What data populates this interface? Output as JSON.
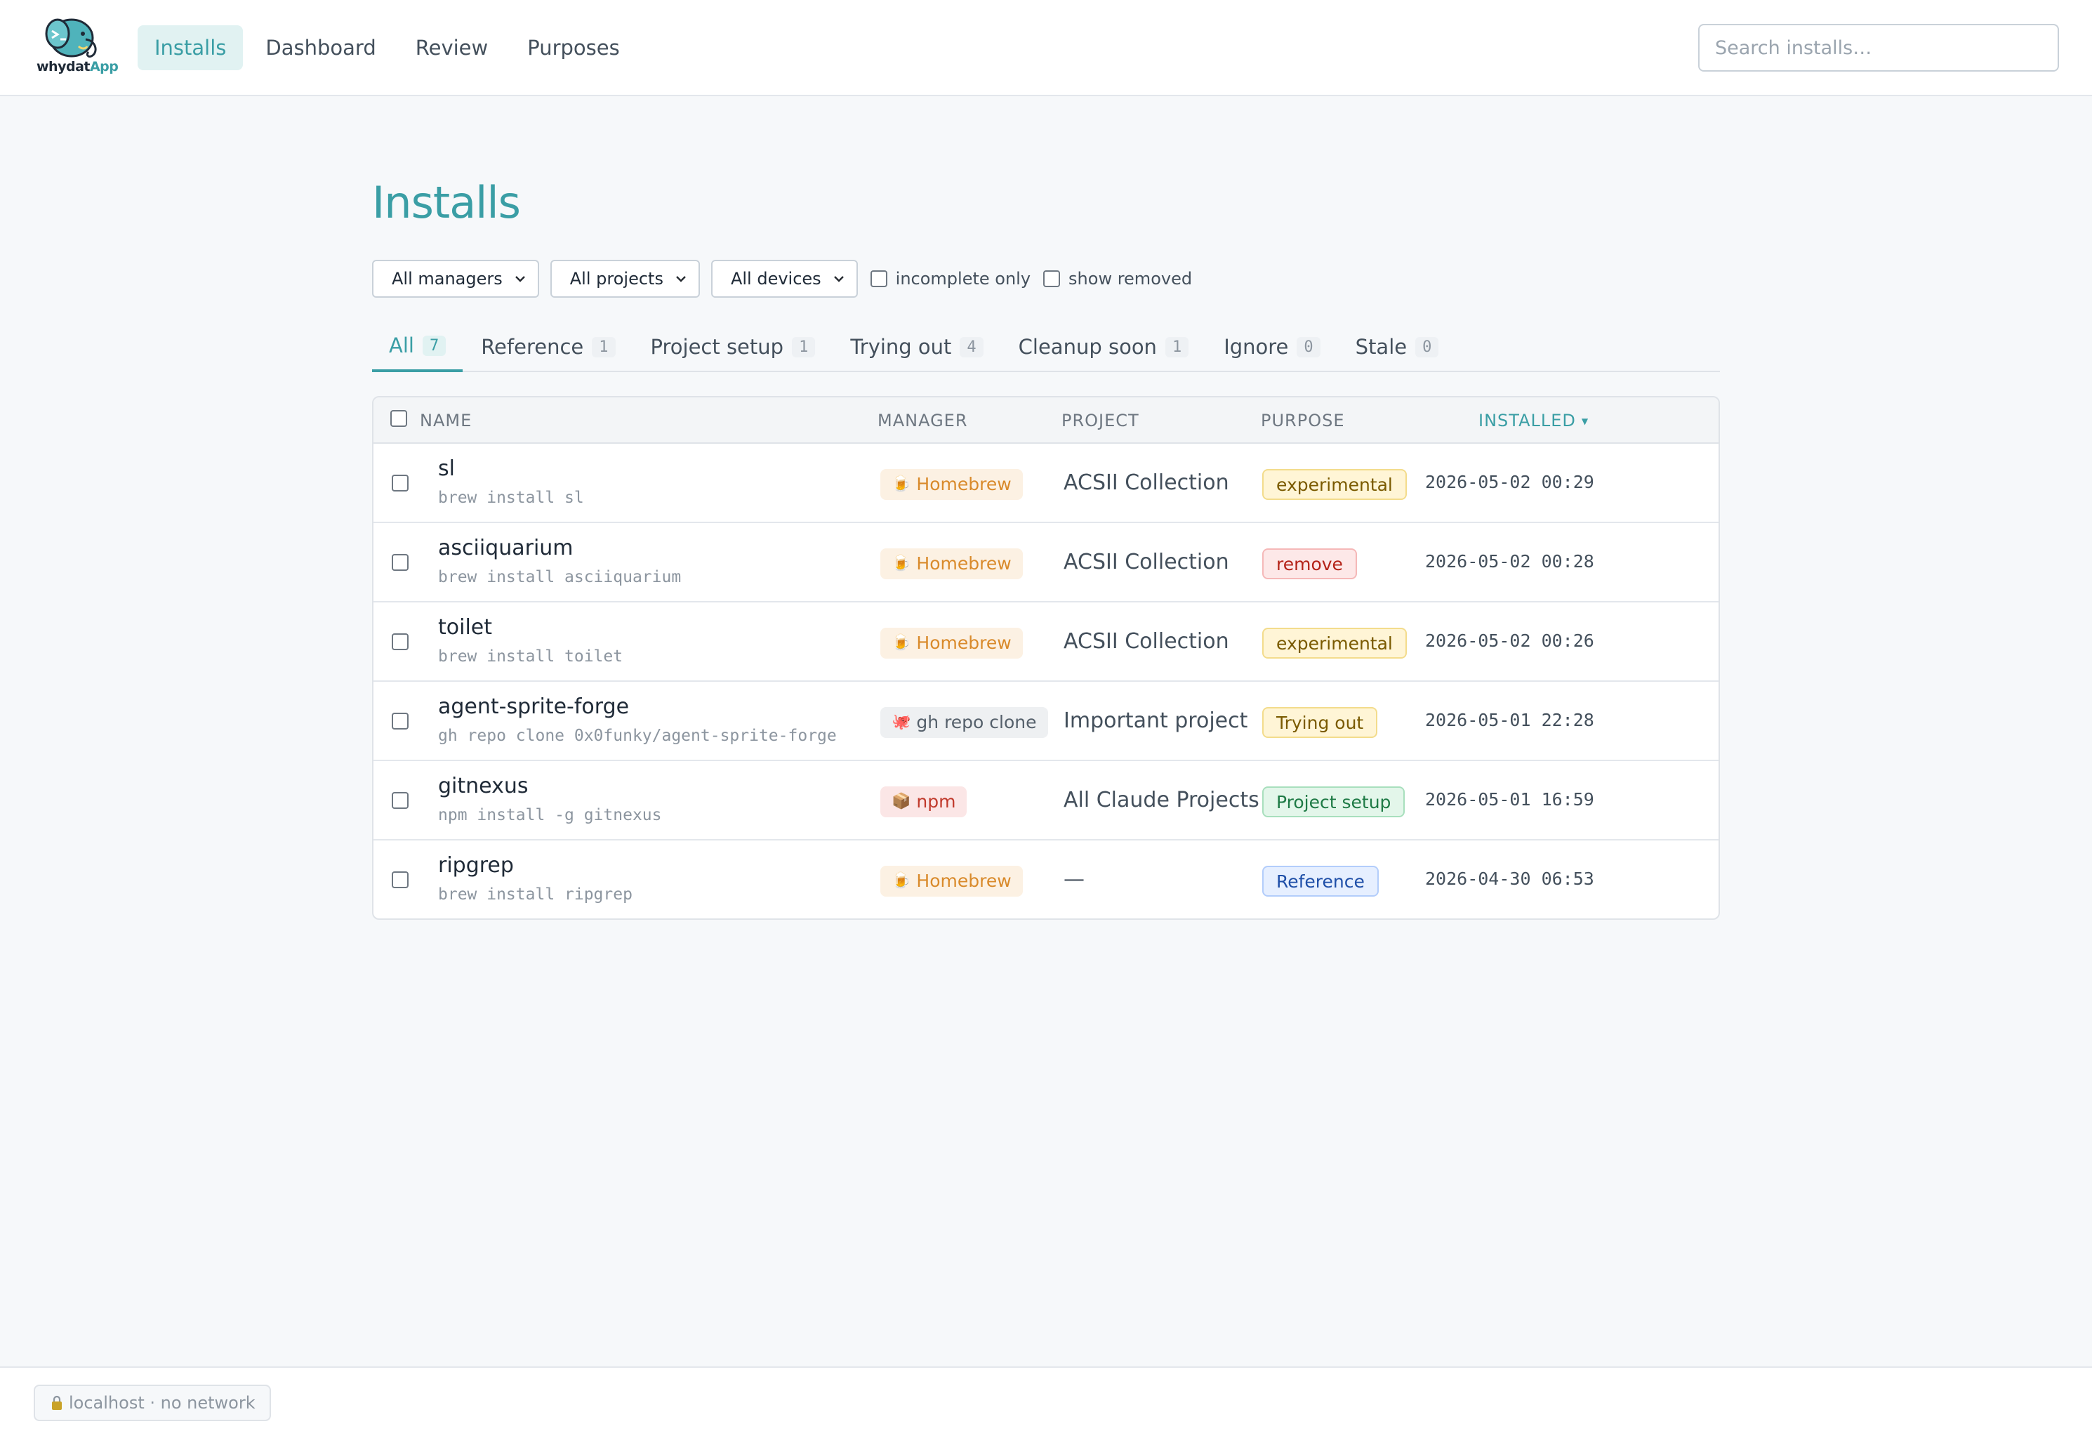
{
  "app": {
    "logo_text_main": "whydat",
    "logo_text_accent": "App"
  },
  "nav": {
    "items": [
      {
        "label": "Installs",
        "active": true
      },
      {
        "label": "Dashboard",
        "active": false
      },
      {
        "label": "Review",
        "active": false
      },
      {
        "label": "Purposes",
        "active": false
      }
    ]
  },
  "search": {
    "placeholder": "Search installs…",
    "value": ""
  },
  "page": {
    "title": "Installs"
  },
  "filters": {
    "manager": "All managers",
    "project": "All projects",
    "device": "All devices",
    "incomplete_only": "incomplete only",
    "show_removed": "show removed"
  },
  "tabs": [
    {
      "label": "All",
      "count": "7",
      "active": true
    },
    {
      "label": "Reference",
      "count": "1"
    },
    {
      "label": "Project setup",
      "count": "1"
    },
    {
      "label": "Trying out",
      "count": "4"
    },
    {
      "label": "Cleanup soon",
      "count": "1"
    },
    {
      "label": "Ignore",
      "count": "0"
    },
    {
      "label": "Stale",
      "count": "0"
    }
  ],
  "table": {
    "columns": {
      "name": "NAME",
      "manager": "MANAGER",
      "project": "PROJECT",
      "purpose": "PURPOSE",
      "installed": "INSTALLED",
      "installed_sort": "▼"
    },
    "rows": [
      {
        "name": "sl",
        "cmd": "brew install sl",
        "manager": "Homebrew",
        "manager_icon": "beer-mug-icon",
        "manager_glyph": "🍺",
        "project": "ACSII Collection",
        "purpose": "experimental",
        "installed": "2026-05-02 00:29"
      },
      {
        "name": "asciiquarium",
        "cmd": "brew install asciiquarium",
        "manager": "Homebrew",
        "manager_icon": "beer-mug-icon",
        "manager_glyph": "🍺",
        "project": "ACSII Collection",
        "purpose": "remove",
        "installed": "2026-05-02 00:28"
      },
      {
        "name": "toilet",
        "cmd": "brew install toilet",
        "manager": "Homebrew",
        "manager_icon": "beer-mug-icon",
        "manager_glyph": "🍺",
        "project": "ACSII Collection",
        "purpose": "experimental",
        "installed": "2026-05-02 00:26"
      },
      {
        "name": "agent-sprite-forge",
        "cmd": "gh repo clone 0x0funky/agent-sprite-forge",
        "manager": "gh repo clone",
        "manager_icon": "octopus-icon",
        "manager_glyph": "🐙",
        "project": "Important project",
        "purpose": "Trying out",
        "installed": "2026-05-01 22:28"
      },
      {
        "name": "gitnexus",
        "cmd": "npm install -g gitnexus",
        "manager": "npm",
        "manager_icon": "package-icon",
        "manager_glyph": "📦",
        "project": "All Claude Projects",
        "purpose": "Project setup",
        "installed": "2026-05-01 16:59"
      },
      {
        "name": "ripgrep",
        "cmd": "brew install ripgrep",
        "manager": "Homebrew",
        "manager_icon": "beer-mug-icon",
        "manager_glyph": "🍺",
        "project": "—",
        "purpose": "Reference",
        "installed": "2026-04-30 06:53"
      }
    ]
  },
  "footer": {
    "status": "localhost · no network"
  },
  "colors": {
    "accent": "#3a9ea5",
    "homebrew": "#d98a2b",
    "npm": "#c0392b",
    "experimental": "#fff5d6",
    "remove": "#fde8e8",
    "setup": "#e3f6ea",
    "reference": "#e6efff"
  }
}
